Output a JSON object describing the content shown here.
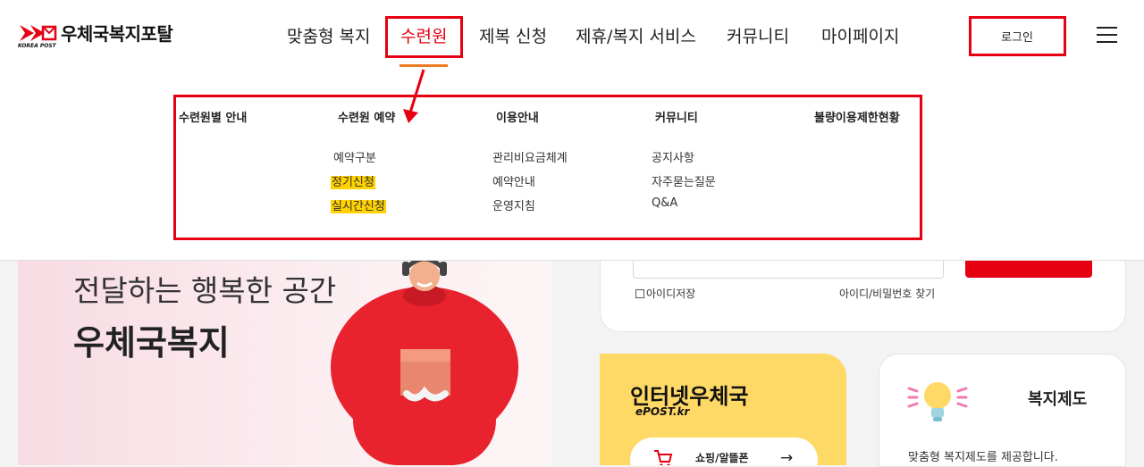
{
  "header": {
    "logo_text": "우체국복지포탈",
    "logo_sub": "KOREA POST",
    "nav": [
      "맞춤형 복지",
      "수련원",
      "제복 신청",
      "제휴/복지 서비스",
      "커뮤니티",
      "마이페이지"
    ],
    "login_label": "로그인",
    "menu_icon": "hamburger-menu-icon"
  },
  "dropdown": {
    "columns": [
      {
        "title": "수련원별 안내",
        "items": []
      },
      {
        "title": "수련원 예약",
        "items": [
          "예약구분",
          "정기신청",
          "실시간신청"
        ]
      },
      {
        "title": "이용안내",
        "items": [
          "관리비요금체계",
          "예약안내",
          "운영지침"
        ]
      },
      {
        "title": "커뮤니티",
        "items": [
          "공지사항",
          "자주묻는질문",
          "Q&A"
        ]
      },
      {
        "title": "불량이용제한현황",
        "items": []
      }
    ]
  },
  "banner": {
    "line1": "전달하는 행복한 공간",
    "line2": "우체국복지"
  },
  "login_panel": {
    "save_id": "아이디저장",
    "find_link": "아이디/비밀번호 찾기"
  },
  "epost": {
    "title": "인터넷우체국",
    "subtitle": "ePOST.kr",
    "shop_label": "쇼핑/알뜰폰"
  },
  "welfare": {
    "title": "복지제도",
    "desc": "맞춤형 복지제도를 제공합니다."
  },
  "colors": {
    "brand_red": "#e60012",
    "highlight": "#ffd200",
    "underline": "#f07a22",
    "epost_yellow": "#ffd965"
  }
}
